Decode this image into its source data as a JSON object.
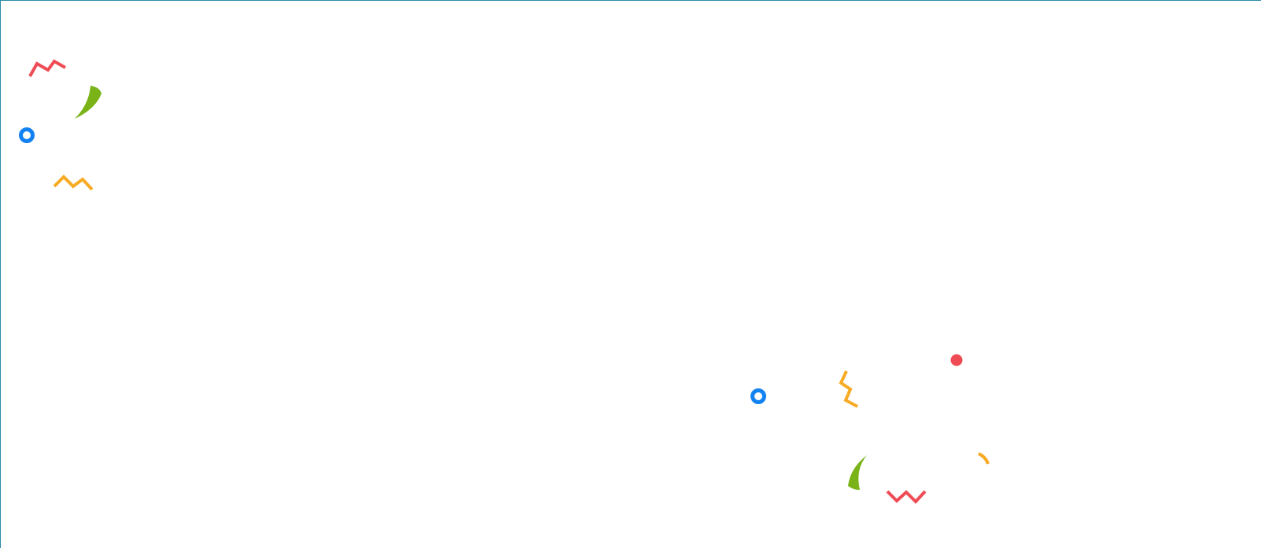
{
  "colors": {
    "red": "#ef4b55",
    "green": "#7ab317",
    "blue": "#1282f0",
    "orange": "#f7ab24",
    "frame": "#2a8aa8",
    "background": "#ffffff"
  },
  "confetti_groups": [
    {
      "name": "top-left-cluster",
      "pieces": [
        {
          "shape": "zigzag",
          "color": "red"
        },
        {
          "shape": "crescent",
          "color": "green"
        },
        {
          "shape": "ring",
          "color": "blue"
        },
        {
          "shape": "zigzag",
          "color": "orange"
        }
      ]
    },
    {
      "name": "bottom-right-cluster",
      "pieces": [
        {
          "shape": "dot",
          "color": "red"
        },
        {
          "shape": "ring",
          "color": "blue"
        },
        {
          "shape": "zigzag-vertical",
          "color": "orange"
        },
        {
          "shape": "crescent",
          "color": "green"
        },
        {
          "shape": "arc",
          "color": "orange"
        },
        {
          "shape": "zigzag",
          "color": "red"
        }
      ]
    }
  ]
}
